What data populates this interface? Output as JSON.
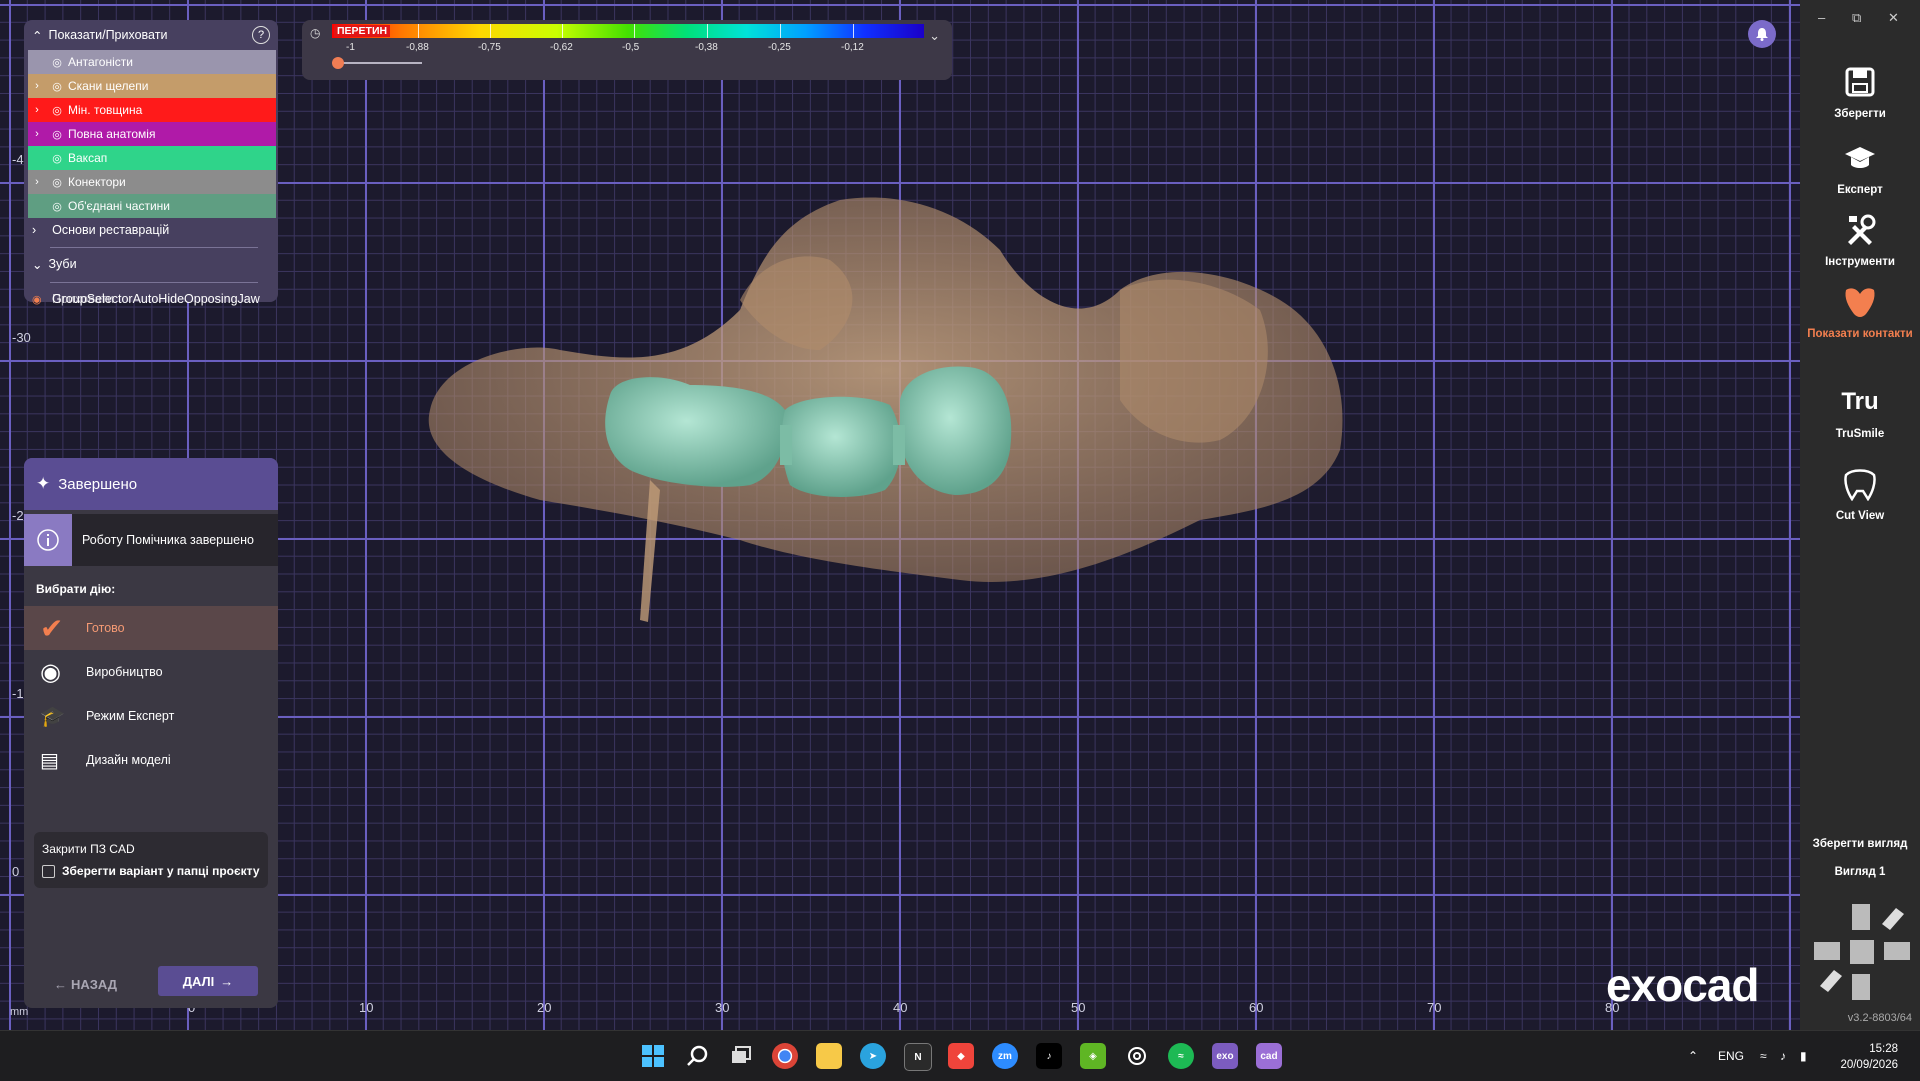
{
  "viewport": {
    "x_ticks": [
      "0",
      "10",
      "20",
      "30",
      "40",
      "50",
      "60",
      "70",
      "80"
    ],
    "y_ticks": [
      "-4",
      "-30",
      "-2",
      "-1",
      "0"
    ],
    "unit": "mm"
  },
  "showhide": {
    "title": "Показати/Приховати",
    "help": "?",
    "items": [
      {
        "label": "Антагоністи",
        "bg": "#9a95ad",
        "chevron": false
      },
      {
        "label": "Скани щелепи",
        "bg": "#c49c6a",
        "chevron": true
      },
      {
        "label": "Мін. товщина",
        "bg": "#ff1a1a",
        "chevron": true
      },
      {
        "label": "Повна анатомія",
        "bg": "#b01aa8",
        "chevron": true
      },
      {
        "label": "Ваксап",
        "bg": "#2fd48a",
        "chevron": false
      },
      {
        "label": "Конектори",
        "bg": "#8c8c8c",
        "chevron": true
      },
      {
        "label": "Об'єднані частини",
        "bg": "#5f9e82",
        "chevron": false
      }
    ],
    "base_item": "Основи реставрацій",
    "teeth": "Зуби",
    "overlay_text": "GroupSelectorAutoHideOpposingJaw",
    "overlay_under": "Приховати"
  },
  "scale": {
    "title": "ПЕРЕТИН",
    "labels": [
      "-1",
      "-0,88",
      "-0,75",
      "-0,62",
      "-0,5",
      "-0,38",
      "-0,25",
      "-0,12"
    ],
    "slider_value": 0
  },
  "wizard": {
    "title": "Завершено",
    "info": "Роботу Помічника завершено",
    "choose": "Вибрати дію:",
    "options": [
      "Готово",
      "Виробництво",
      "Режим Експерт",
      "Дизайн моделі"
    ],
    "close_title": "Закрити ПЗ CAD",
    "save_variant": "Зберегти варіант у папці проєкту",
    "back": "НАЗАД",
    "next": "ДАЛІ"
  },
  "toolbar": {
    "save": "Зберегти",
    "expert": "Експерт",
    "tools": "Інструменти",
    "contacts": "Показати контакти",
    "trusmile": "TruSmile",
    "cutview": "Cut View",
    "save_view": "Зберегти вигляд",
    "view1": "Вигляд 1",
    "version": "v3.2-8803/64",
    "accent": "#f37f4f"
  },
  "brand": "exocad",
  "taskbar": {
    "lang": "ENG",
    "time": "15:28",
    "date": "20/09/2026",
    "apps": [
      "start",
      "search",
      "taskview",
      "chrome",
      "explorer",
      "telegram",
      "notion",
      "anydesk",
      "zoom",
      "tiktok",
      "xbox",
      "chatgpt",
      "spotify",
      "exo",
      "cad"
    ]
  }
}
